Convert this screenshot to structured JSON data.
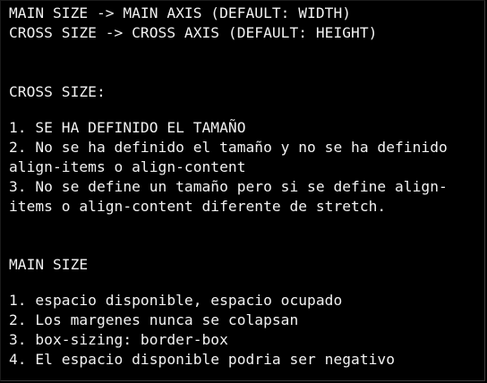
{
  "terminal": {
    "header": {
      "line1": "MAIN SIZE -> MAIN AXIS (DEFAULT: WIDTH)",
      "line2": "CROSS SIZE -> CROSS AXIS (DEFAULT: HEIGHT)"
    },
    "cross_size": {
      "heading": "CROSS SIZE:",
      "lines": [
        "1. SE HA DEFINIDO EL TAMAÑO",
        "2. No se ha definido el tamaño y no se ha definido",
        "align-items o align-content",
        "3. No se define un tamaño pero si se define align-",
        "items o align-content diferente de stretch."
      ]
    },
    "main_size": {
      "heading": "MAIN SIZE",
      "lines": [
        "1. espacio disponible, espacio ocupado",
        "2. Los margenes nunca se colapsan",
        "3. box-sizing: border-box",
        "4. El espacio disponible podria ser negativo"
      ]
    }
  }
}
